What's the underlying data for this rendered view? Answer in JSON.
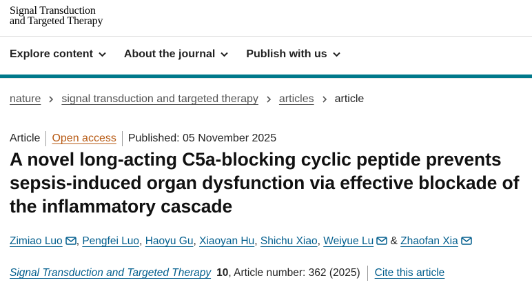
{
  "masthead": {
    "line1": "Signal Transduction",
    "line2": "and Targeted Therapy"
  },
  "nav": [
    {
      "label": "Explore content"
    },
    {
      "label": "About the journal"
    },
    {
      "label": "Publish with us"
    }
  ],
  "breadcrumb": {
    "items": [
      "nature",
      "signal transduction and targeted therapy",
      "articles"
    ],
    "current": "article"
  },
  "meta": {
    "type": "Article",
    "access": "Open access",
    "published": "Published: 05 November 2025"
  },
  "title": "A novel long-acting C5a-blocking cyclic peptide prevents sepsis-induced organ dysfunction via effective blockade of the inflammatory cascade",
  "authors": [
    {
      "name": "Zimiao Luo",
      "email_icon": true
    },
    {
      "name": "Pengfei Luo",
      "email_icon": false
    },
    {
      "name": "Haoyu Gu",
      "email_icon": false
    },
    {
      "name": "Xiaoyan Hu",
      "email_icon": false
    },
    {
      "name": "Shichu Xiao",
      "email_icon": false
    },
    {
      "name": "Weiyue Lu",
      "email_icon": true
    },
    {
      "name": "Zhaofan Xia",
      "email_icon": true
    }
  ],
  "authors_separator": ", ",
  "authors_last_joiner": " & ",
  "citation": {
    "journal": "Signal Transduction and Targeted Therapy",
    "volume": "10",
    "article_number": ", Article number: 362 (2025)",
    "cite_label": "Cite this article"
  },
  "colors": {
    "accent": "#00798b",
    "link": "#025e8d",
    "open_access": "#b75912"
  }
}
